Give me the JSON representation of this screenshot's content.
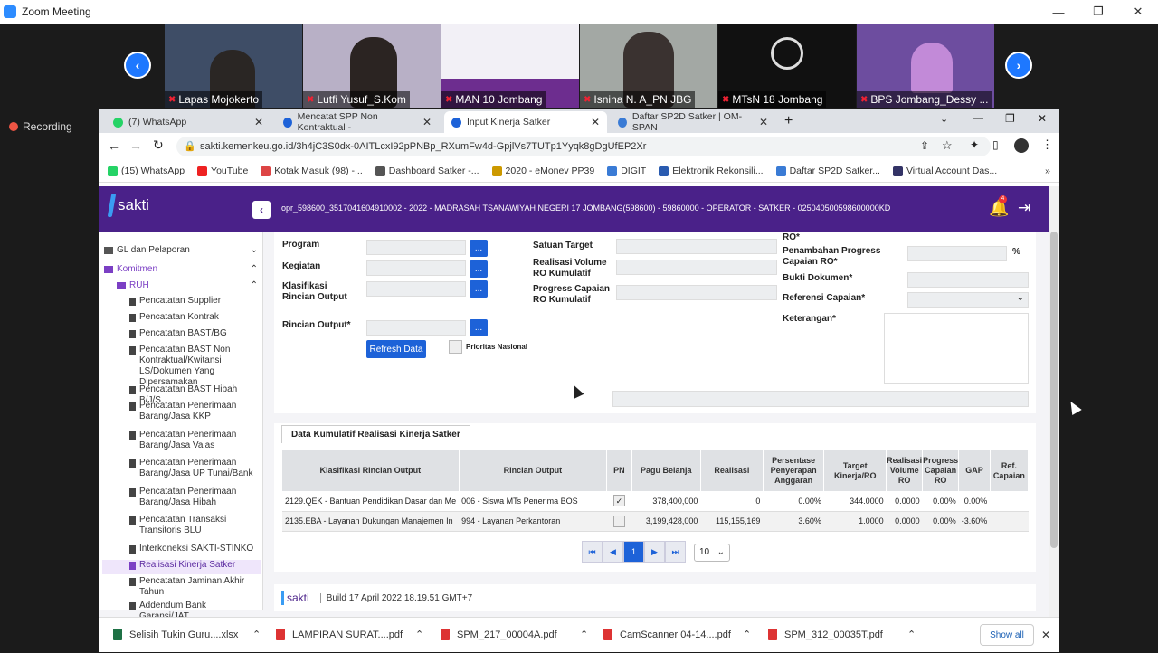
{
  "zoom": {
    "title": "Zoom Meeting",
    "recording": "Recording",
    "participants": [
      {
        "name": "Lapas Mojokerto",
        "bg": "#3e4d66"
      },
      {
        "name": "Lutfi Yusuf_S.Kom",
        "bg": "#b8b0c6"
      },
      {
        "name": "MAN 10 Jombang",
        "bg": "#6d2d8f"
      },
      {
        "name": "Isnina N. A_PN JBG",
        "bg": "#a3a8a4"
      },
      {
        "name": "MTsN 18 Jombang",
        "bg": "#111111"
      },
      {
        "name": "BPS Jombang_Dessy ...",
        "bg": "#6d4d9f"
      }
    ]
  },
  "browser": {
    "tabs": [
      {
        "label": "(7) WhatsApp",
        "color": "#25d366"
      },
      {
        "label": "Mencatat SPP Non Kontraktual -",
        "color": "#1d62d8"
      },
      {
        "label": "Input Kinerja Satker",
        "color": "#1d62d8"
      },
      {
        "label": "Daftar SP2D Satker | OM-SPAN",
        "color": "#3a7bd5"
      }
    ],
    "url": "sakti.kemenkeu.go.id/3h4jC3S0dx-0AITLcxI92pPNBp_RXumFw4d-GpjlVs7TUTp1Yyqk8gDgUfEP2Xr",
    "bookmarks": [
      {
        "label": "(15) WhatsApp",
        "color": "#25d366"
      },
      {
        "label": "YouTube",
        "color": "#e22"
      },
      {
        "label": "Kotak Masuk (98) -...",
        "color": "#d44"
      },
      {
        "label": "Dashboard Satker -...",
        "color": "#555"
      },
      {
        "label": "2020 - eMonev PP39",
        "color": "#c90"
      },
      {
        "label": "DIGIT",
        "color": "#3a7bd5"
      },
      {
        "label": "Elektronik Rekonsili...",
        "color": "#2a5bb0"
      },
      {
        "label": "Daftar SP2D Satker...",
        "color": "#3a7bd5"
      },
      {
        "label": "Virtual Account Das...",
        "color": "#336"
      }
    ]
  },
  "sakti": {
    "logo": "sakti",
    "info": "opr_598600_3517041604910002 - 2022 - MADRASAH TSANAWIYAH NEGERI 17 JOMBANG(598600) - 59860000 - OPERATOR - SATKER - 025040500598600000KD",
    "notif_count": "4",
    "sidebar": {
      "gl": "GL dan Pelaporan",
      "komitmen": "Komitmen",
      "ruh": "RUH",
      "items": [
        "Pencatatan Supplier",
        "Pencatatan Kontrak",
        "Pencatatan BAST/BG",
        "Pencatatan BAST Non Kontraktual/Kwitansi LS/Dokumen Yang Dipersamakan",
        "Pencatatan BAST Hibah B/J/S",
        "Pencatatan Penerimaan Barang/Jasa KKP",
        "Pencatatan Penerimaan Barang/Jasa Valas",
        "Pencatatan Penerimaan Barang/Jasa UP Tunai/Bank",
        "Pencatatan Penerimaan Barang/Jasa Hibah",
        "Pencatatan Transaksi Transitoris BLU",
        "Interkoneksi SAKTI-STINKO",
        "Realisasi Kinerja Satker",
        "Pencatatan Jaminan Akhir Tahun",
        "Addendum Bank Garansi/JAT"
      ]
    },
    "form": {
      "program": "Program",
      "kegiatan": "Kegiatan",
      "klasifikasi": "Klasifikasi Rincian Output",
      "rincian": "Rincian Output*",
      "refresh": "Refresh Data",
      "prioritas": "Prioritas Nasional",
      "satuan_target": "Satuan Target",
      "realisasi_volume": "Realisasi Volume RO Kumulatif",
      "progress_capaian": "Progress Capaian RO Kumulatif",
      "ro": "RO*",
      "penambahan": "Penambahan Progress Capaian RO*",
      "pct": "%",
      "bukti": "Bukti Dokumen*",
      "referensi": "Referensi Capaian*",
      "keterangan": "Keterangan*"
    },
    "table": {
      "title": "Data Kumulatif Realisasi Kinerja Satker",
      "headers": [
        "Klasifikasi Rincian Output",
        "Rincian Output",
        "PN",
        "Pagu Belanja",
        "Realisasi",
        "Persentase Penyerapan Anggaran",
        "Target Kinerja/RO",
        "Realisasi Volume RO",
        "Progress Capaian RO",
        "GAP",
        "Ref. Capaian"
      ],
      "rows": [
        [
          "2129.QEK - Bantuan Pendidikan Dasar dan Me",
          "006 - Siswa MTs Penerima BOS",
          "✓",
          "378,400,000",
          "0",
          "0.00%",
          "344.0000",
          "0.0000",
          "0.00%",
          "0.00%",
          ""
        ],
        [
          "2135.EBA - Layanan Dukungan Manajemen In",
          "994 - Layanan Perkantoran",
          "",
          "3,199,428,000",
          "115,155,169",
          "3.60%",
          "1.0000",
          "0.0000",
          "0.00%",
          "-3.60%",
          ""
        ]
      ],
      "page": "1",
      "page_size": "10"
    },
    "footer": "Build 17 April 2022 18.19.51 GMT+7"
  },
  "downloads": {
    "items": [
      "Selisih Tukin Guru....xlsx",
      "LAMPIRAN SURAT....pdf",
      "SPM_217_00004A.pdf",
      "CamScanner 04-14....pdf",
      "SPM_312_00035T.pdf"
    ],
    "show_all": "Show all"
  }
}
